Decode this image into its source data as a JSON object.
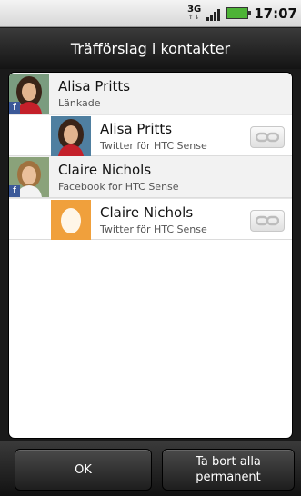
{
  "status_bar": {
    "network": "3G",
    "time": "17:07"
  },
  "title": "Träfförslag i kontakter",
  "contacts": [
    {
      "name": "Alisa Pritts",
      "subtitle": "Länkade",
      "badge": "f",
      "suggestion": {
        "name": "Alisa Pritts",
        "subtitle": "Twitter för HTC Sense"
      }
    },
    {
      "name": "Claire Nichols",
      "subtitle": "Facebook for HTC Sense",
      "badge": "f",
      "suggestion": {
        "name": "Claire Nichols",
        "subtitle": "Twitter för HTC Sense"
      }
    }
  ],
  "buttons": {
    "ok": "OK",
    "remove_all": "Ta bort alla permanent"
  },
  "colors": {
    "facebook_badge": "#3b5998",
    "battery": "#4db336",
    "egg_avatar_bg": "#f0a03c"
  },
  "icons": {
    "link": "chain-link-icon",
    "egg_avatar": "twitter-egg-avatar"
  }
}
